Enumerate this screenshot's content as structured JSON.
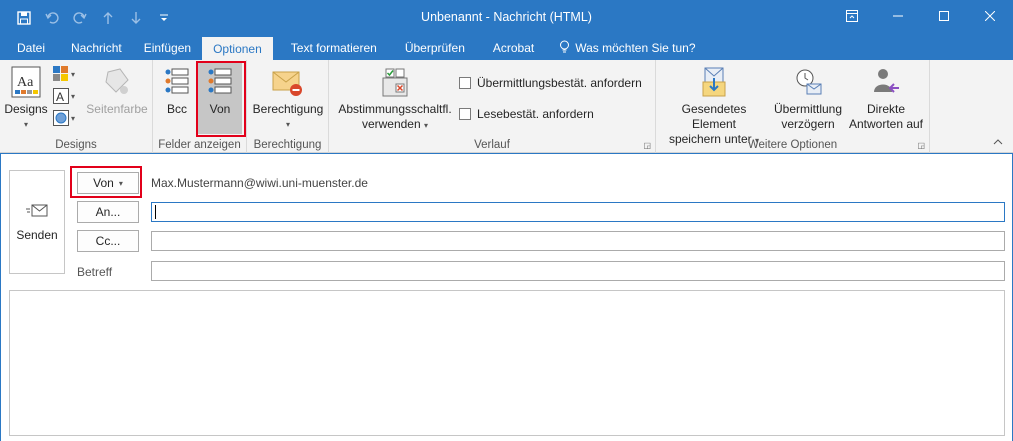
{
  "window": {
    "title": "Unbenannt - Nachricht (HTML)"
  },
  "tabs": [
    {
      "label": "Datei"
    },
    {
      "label": "Nachricht"
    },
    {
      "label": "Einfügen"
    },
    {
      "label": "Optionen"
    },
    {
      "label": "Text formatieren"
    },
    {
      "label": "Überprüfen"
    },
    {
      "label": "Acrobat"
    },
    {
      "label": "Was möchten Sie tun?"
    }
  ],
  "ribbon": {
    "designs": {
      "designs_label": "Designs",
      "seitenfarbe_label": "Seitenfarbe",
      "group_title": "Designs"
    },
    "felder": {
      "bcc_label": "Bcc",
      "von_label": "Von",
      "group_title": "Felder anzeigen"
    },
    "berechtigung": {
      "label": "Berechtigung",
      "group_title": "Berechtigung"
    },
    "verlauf": {
      "abstimmung_line1": "Abstimmungsschaltfl.",
      "abstimmung_line2": "verwenden",
      "check1": "Übermittlungsbestät. anfordern",
      "check2": "Lesebestät. anfordern",
      "group_title": "Verlauf"
    },
    "weitere": {
      "gesendet_line1": "Gesendetes Element",
      "gesendet_line2": "speichern unter",
      "verzoegern_line1": "Übermittlung",
      "verzoegern_line2": "verzögern",
      "direkt_line1": "Direkte",
      "direkt_line2": "Antworten auf",
      "group_title": "Weitere Optionen"
    }
  },
  "compose": {
    "send_label": "Senden",
    "from_button": "Von",
    "from_value": "Max.Mustermann@wiwi.uni-muenster.de",
    "to_button": "An...",
    "cc_button": "Cc...",
    "subject_label": "Betreff",
    "to_value": "",
    "cc_value": "",
    "subject_value": ""
  },
  "colors": {
    "accent": "#2b78c4",
    "highlight": "#e2001a",
    "ribbon_bg": "#f3f3f3"
  }
}
